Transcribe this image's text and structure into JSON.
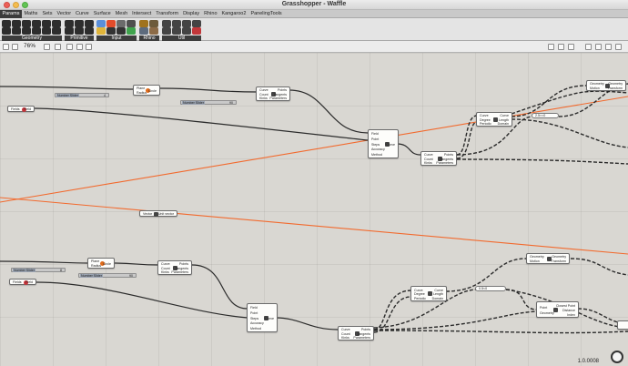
{
  "window": {
    "title": "Grasshopper - Waffle"
  },
  "tabs": [
    "Params",
    "Maths",
    "Sets",
    "Vector",
    "Curve",
    "Surface",
    "Mesh",
    "Intersect",
    "Transform",
    "Display",
    "Rhino",
    "Kangaroo2",
    "PanelingTools"
  ],
  "active_tab": "Params",
  "ribbon": {
    "groups": [
      "Geometry",
      "Primitive",
      "Input",
      "Rhino",
      "Util"
    ]
  },
  "canvas_toolbar": {
    "zoom": "76%"
  },
  "nodes": {
    "pf": {
      "f_in": "Field",
      "p_in": "Point",
      "s_in": "Steps",
      "a_in": "Accuracy",
      "m_in": "Method",
      "c_out": "Curve"
    },
    "ev": {
      "c_in": "Curve",
      "k_in": "Count",
      "kn_in": "Kinks",
      "p_out": "Points",
      "t_out": "Tangents",
      "pa_out": "Parameters"
    },
    "circle": {
      "p_in": "Plane",
      "r_in": "Radius",
      "c_out": "Circle"
    },
    "field": {
      "f_in": "Fields",
      "f_out": "Field"
    },
    "reparam": {
      "c_in": "Curve",
      "d_in": "Degree",
      "p_in": "Periodic",
      "c_out": "Curve",
      "l_out": "Length",
      "d_out": "Domain"
    },
    "move": {
      "g_in": "Geometry",
      "m_in": "Motion",
      "g_out": "Geometry",
      "t_out": "Transform"
    },
    "cp": {
      "p_in": "Point",
      "g_in": "Geometry",
      "c_out": "Closest Point",
      "i_out": "Index",
      "d_out": "Distance"
    },
    "vec": {
      "f_in": "Vector",
      "f_out": "Unit vector"
    }
  },
  "sliders": {
    "s1": {
      "label": "Number Slider",
      "value": "4"
    },
    "s2": {
      "label": "Number Slider",
      "value": "90"
    },
    "s3": {
      "label": "Number Slider",
      "value": "8"
    },
    "s4": {
      "label": "Number Slider",
      "value": "90"
    }
  },
  "panels": {
    "p1": "2.5<<0",
    "p2": "0.5<0"
  },
  "status": {
    "version": "1.0.0008"
  },
  "colors": {
    "canvas": "#d9d7d2",
    "orange_wire": "#f26a2e",
    "wire": "#2b2b2b"
  }
}
